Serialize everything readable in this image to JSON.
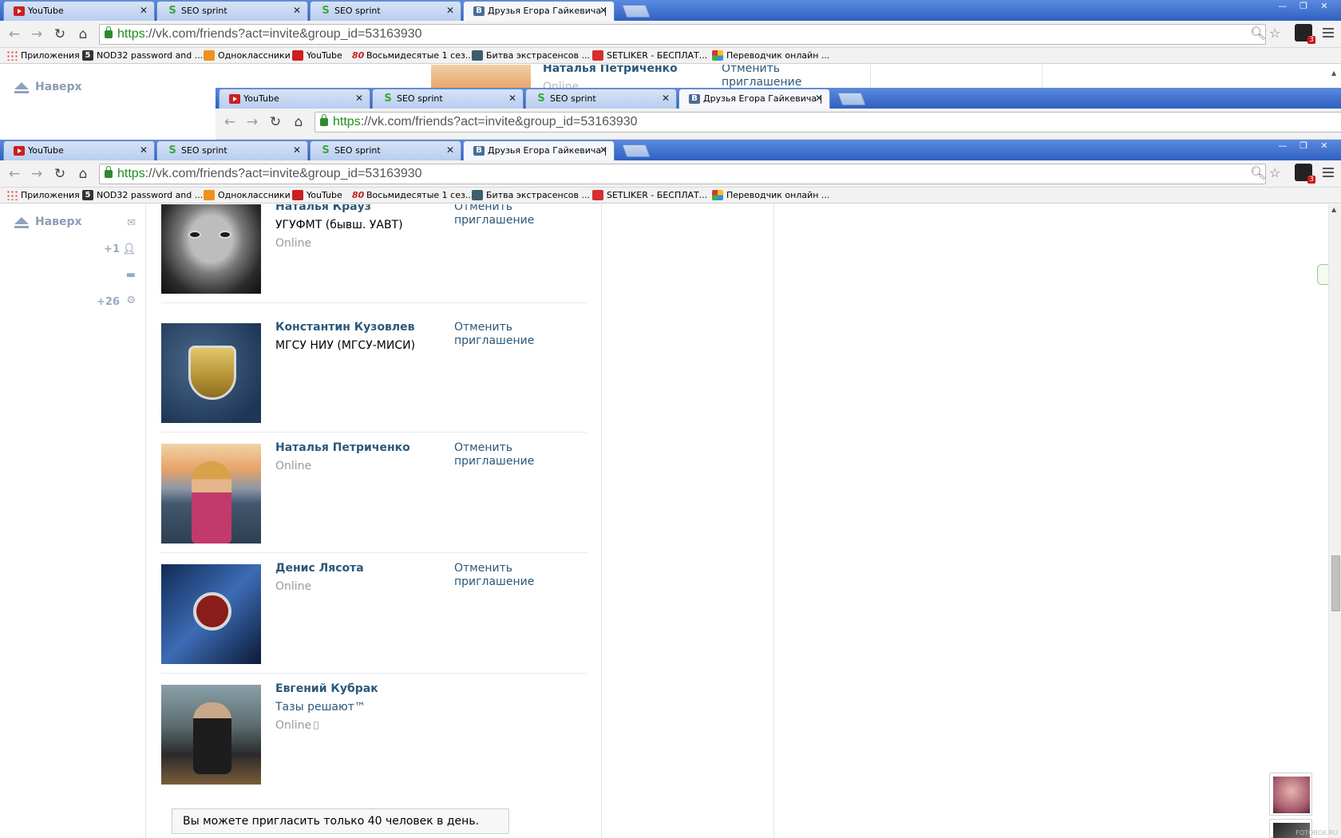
{
  "tabs": [
    {
      "title": "YouTube",
      "icon": "youtube-icon"
    },
    {
      "title": "SEO sprint",
      "icon": "seo-sprint-icon"
    },
    {
      "title": "SEO sprint",
      "icon": "seo-sprint-icon"
    },
    {
      "title": "Друзья Егора Гайкевича | ",
      "icon": "vk-icon"
    }
  ],
  "address": {
    "scheme": "https",
    "rest": "://vk.com/friends?act=invite&group_id=53163930"
  },
  "bookmarks": [
    {
      "label": "Приложения",
      "icon": "apps-icon"
    },
    {
      "label": "NOD32 password and ...",
      "icon": "nod32-icon"
    },
    {
      "label": "Одноклассники",
      "icon": "odnoklassniki-icon"
    },
    {
      "label": "YouTube",
      "icon": "youtube-icon"
    },
    {
      "label": "Восьмидесятые 1 сез...",
      "icon": "eighties-icon"
    },
    {
      "label": "Битва экстрасенсов ...",
      "icon": "bitva-icon"
    },
    {
      "label": "SETLIKER - БЕСПЛАТ...",
      "icon": "setliker-icon"
    },
    {
      "label": "Переводчик онлайн ...",
      "icon": "translator-icon"
    }
  ],
  "extension_badge": "3",
  "sidebar": {
    "up_label": "Наверх",
    "friends_count": "+1",
    "settings_count": "+26"
  },
  "behind_window": {
    "friend_name": "Наталья Петриченко",
    "online": "Online",
    "cancel_line1": "Отменить",
    "cancel_line2": "приглашение"
  },
  "friends": [
    {
      "name": "Наталья Крауз",
      "sub": "УГУФМТ (бывш. УАВТ)",
      "online": "Online",
      "cancel": "Отменить приглашение"
    },
    {
      "name": "Константин Кузовлев",
      "sub": "МГСУ НИУ (МГСУ-МИСИ)",
      "online": "",
      "cancel": "Отменить приглашение"
    },
    {
      "name": "Наталья Петриченко",
      "sub": "",
      "online": "Online",
      "cancel": "Отменить приглашение"
    },
    {
      "name": "Денис Лясота",
      "sub": "",
      "online": "Online",
      "cancel": "Отменить приглашение"
    },
    {
      "name": "Евгений Кубрак",
      "sub": "Тазы решают™",
      "online": "Online",
      "cancel": "Отменить приглашение"
    }
  ],
  "limit_notice": "Вы можете пригласить только 40 человек в день.",
  "watermark": "FOTOBOX.RU"
}
